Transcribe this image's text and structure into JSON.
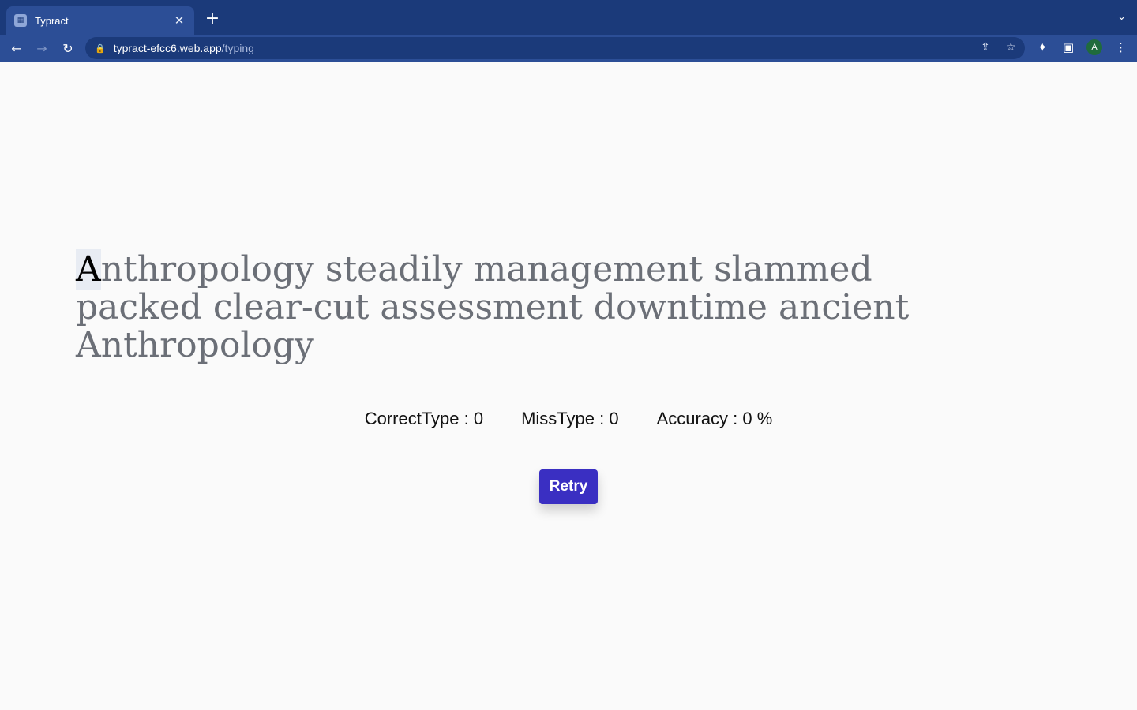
{
  "browser": {
    "tab_title": "Typract",
    "tab_close": "✕",
    "new_tab": "+",
    "tab_list": "⌄",
    "url_host": "typract-efcc6.web.app",
    "url_path": "/typing",
    "avatar_letter": "A"
  },
  "icons": {
    "back": "←",
    "forward": "→",
    "reload": "↻",
    "lock": "🔒",
    "share": "⇪",
    "star": "☆",
    "extensions": "✦",
    "sidepanel": "▣",
    "menu": "⋮",
    "favicon": "▦"
  },
  "typing": {
    "current_char": "A",
    "remaining_text": "nthropology steadily management slammed packed clear-cut assessment downtime ancient Anthropology"
  },
  "stats": {
    "correct": "CorrectType : 0",
    "miss": "MissType : 0",
    "accuracy": "Accuracy : 0 %"
  },
  "retry_label": "Retry"
}
